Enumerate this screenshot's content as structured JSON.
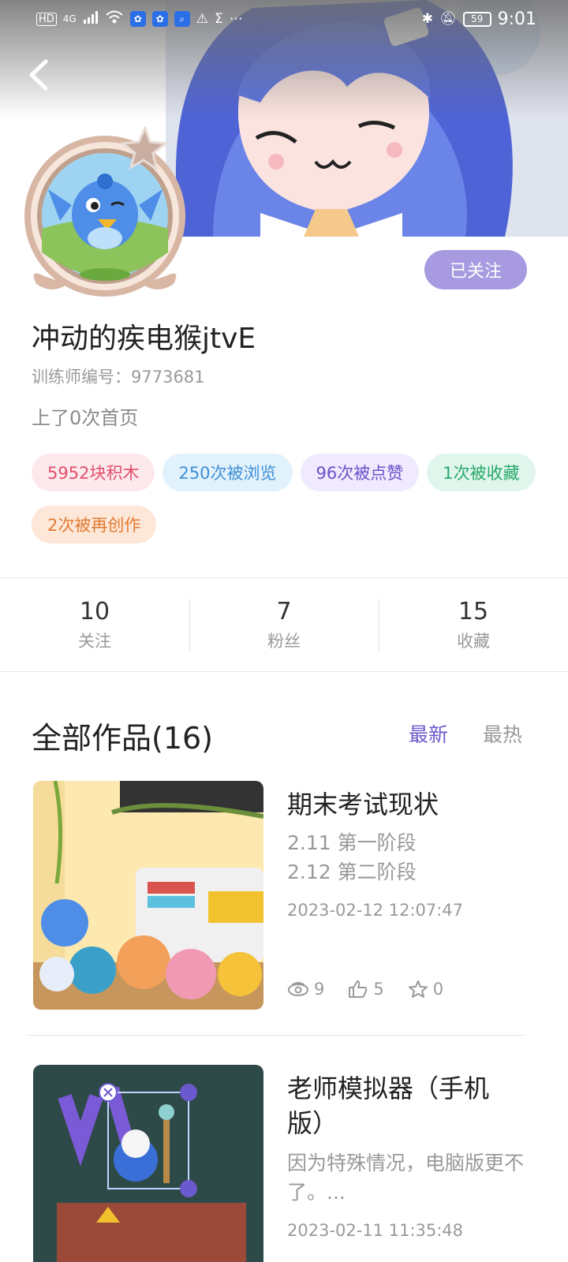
{
  "status_bar": {
    "left_labels": [
      "HD",
      "4G"
    ],
    "battery": "59",
    "time": "9:01"
  },
  "profile": {
    "follow_label": "已关注",
    "username": "冲动的疾电猴jtvE",
    "trainer_id": "训练师编号：9773681",
    "frontpage": "上了0次首页",
    "tags": [
      {
        "label": "5952块积木",
        "color": "#e0506a"
      },
      {
        "label": "250次被浏览",
        "color": "#3e8fd4"
      },
      {
        "label": "96次被点赞",
        "color": "#6d4fc9"
      },
      {
        "label": "1次被收藏",
        "color": "#27a86a"
      },
      {
        "label": "2次被再创作",
        "color": "#e07a32"
      }
    ]
  },
  "stats": [
    {
      "value": "10",
      "label": "关注"
    },
    {
      "value": "7",
      "label": "粉丝"
    },
    {
      "value": "15",
      "label": "收藏"
    }
  ],
  "works": {
    "title": "全部作品(16)",
    "sort_newest": "最新",
    "sort_hottest": "最热",
    "accent": "#6a5acd",
    "items": [
      {
        "title": "期末考试现状",
        "desc_lines": [
          "2.11 第一阶段",
          "2.12 第二阶段"
        ],
        "date": "2023-02-12 12:07:47",
        "views": "9",
        "likes": "5",
        "stars": "0"
      },
      {
        "title": "老师模拟器（手机版）",
        "desc_lines": [
          "因为特殊情况，电脑版更不了。..."
        ],
        "date": "2023-02-11 11:35:48"
      }
    ]
  }
}
